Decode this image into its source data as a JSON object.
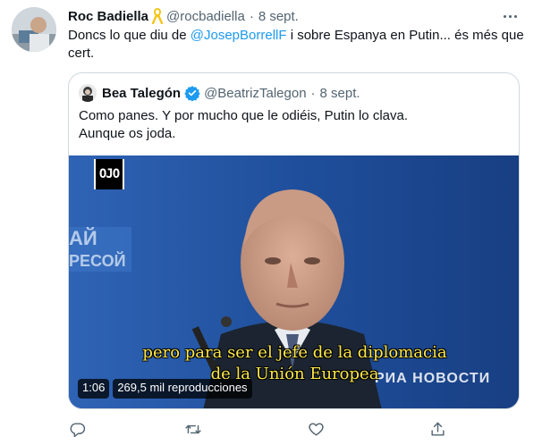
{
  "tweet": {
    "author_name": "Roc Badiella",
    "author_badge_icon": "yellow-ribbon-icon",
    "author_handle": "@rocbadiella",
    "separator": "·",
    "date": "8 sept.",
    "text_before": "Doncs lo que diu de ",
    "mention": "@JosepBorrellF",
    "text_after": " i sobre Espanya en Putin... és més que cert."
  },
  "quoted_tweet": {
    "author_name": "Bea Talegón",
    "author_handle": "@BeatrizTalegon",
    "separator": "·",
    "date": "8 sept.",
    "text_line1": "Como panes. Y por mucho que le odiéis, Putin lo clava.",
    "text_line2": "Aunque os joda.",
    "video": {
      "channel_logo": "OJO",
      "subtitle_line1": "pero para ser el jefe de la diplomacia",
      "subtitle_line2": "de la Unión Europea",
      "watermark": "РИА НОВОСТИ",
      "duration": "1:06",
      "views": "269,5 mil reproducciones"
    }
  },
  "actions": [
    "reply-icon",
    "retweet-icon",
    "like-icon",
    "share-icon"
  ],
  "colors": {
    "accent": "#1d9bf0",
    "muted": "#536471",
    "subtitle": "#ffe94a",
    "border": "#cfd9de"
  }
}
